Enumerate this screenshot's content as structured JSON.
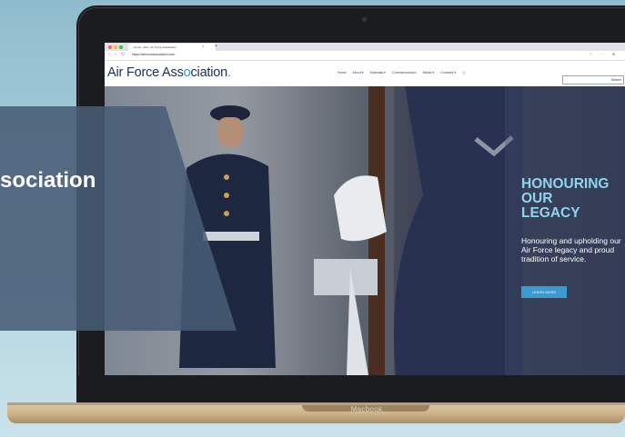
{
  "browser": {
    "tab_title": "Home - AFA - Air Force Association",
    "url": "https://airforceassociation.com",
    "tab_close": "×",
    "tab_new": "+"
  },
  "site": {
    "logo_text_a": "Air Force Ass",
    "logo_text_o": "o",
    "logo_text_b": "ciation",
    "logo_suffix": ".",
    "menu": [
      "Home",
      "About ▾",
      "Materials ▾",
      "Commemoration",
      "Media ▾",
      "Contacts ▾",
      "🛒"
    ],
    "search_button": "Search"
  },
  "hero": {
    "title_line1": "HONOURING",
    "title_line2": "OUR",
    "title_line3": "LEGACY",
    "subtitle": "Honouring and upholding our Air Force legacy and proud tradition of service.",
    "button": "LEARN MORE"
  },
  "overlay": {
    "text": "sociation"
  },
  "device": {
    "label": "Macbook"
  },
  "colors": {
    "accent": "#3a9bd0",
    "hero_title": "#8fd4ee",
    "logo_navy": "#1c2f57",
    "overlay": "#485c75"
  }
}
